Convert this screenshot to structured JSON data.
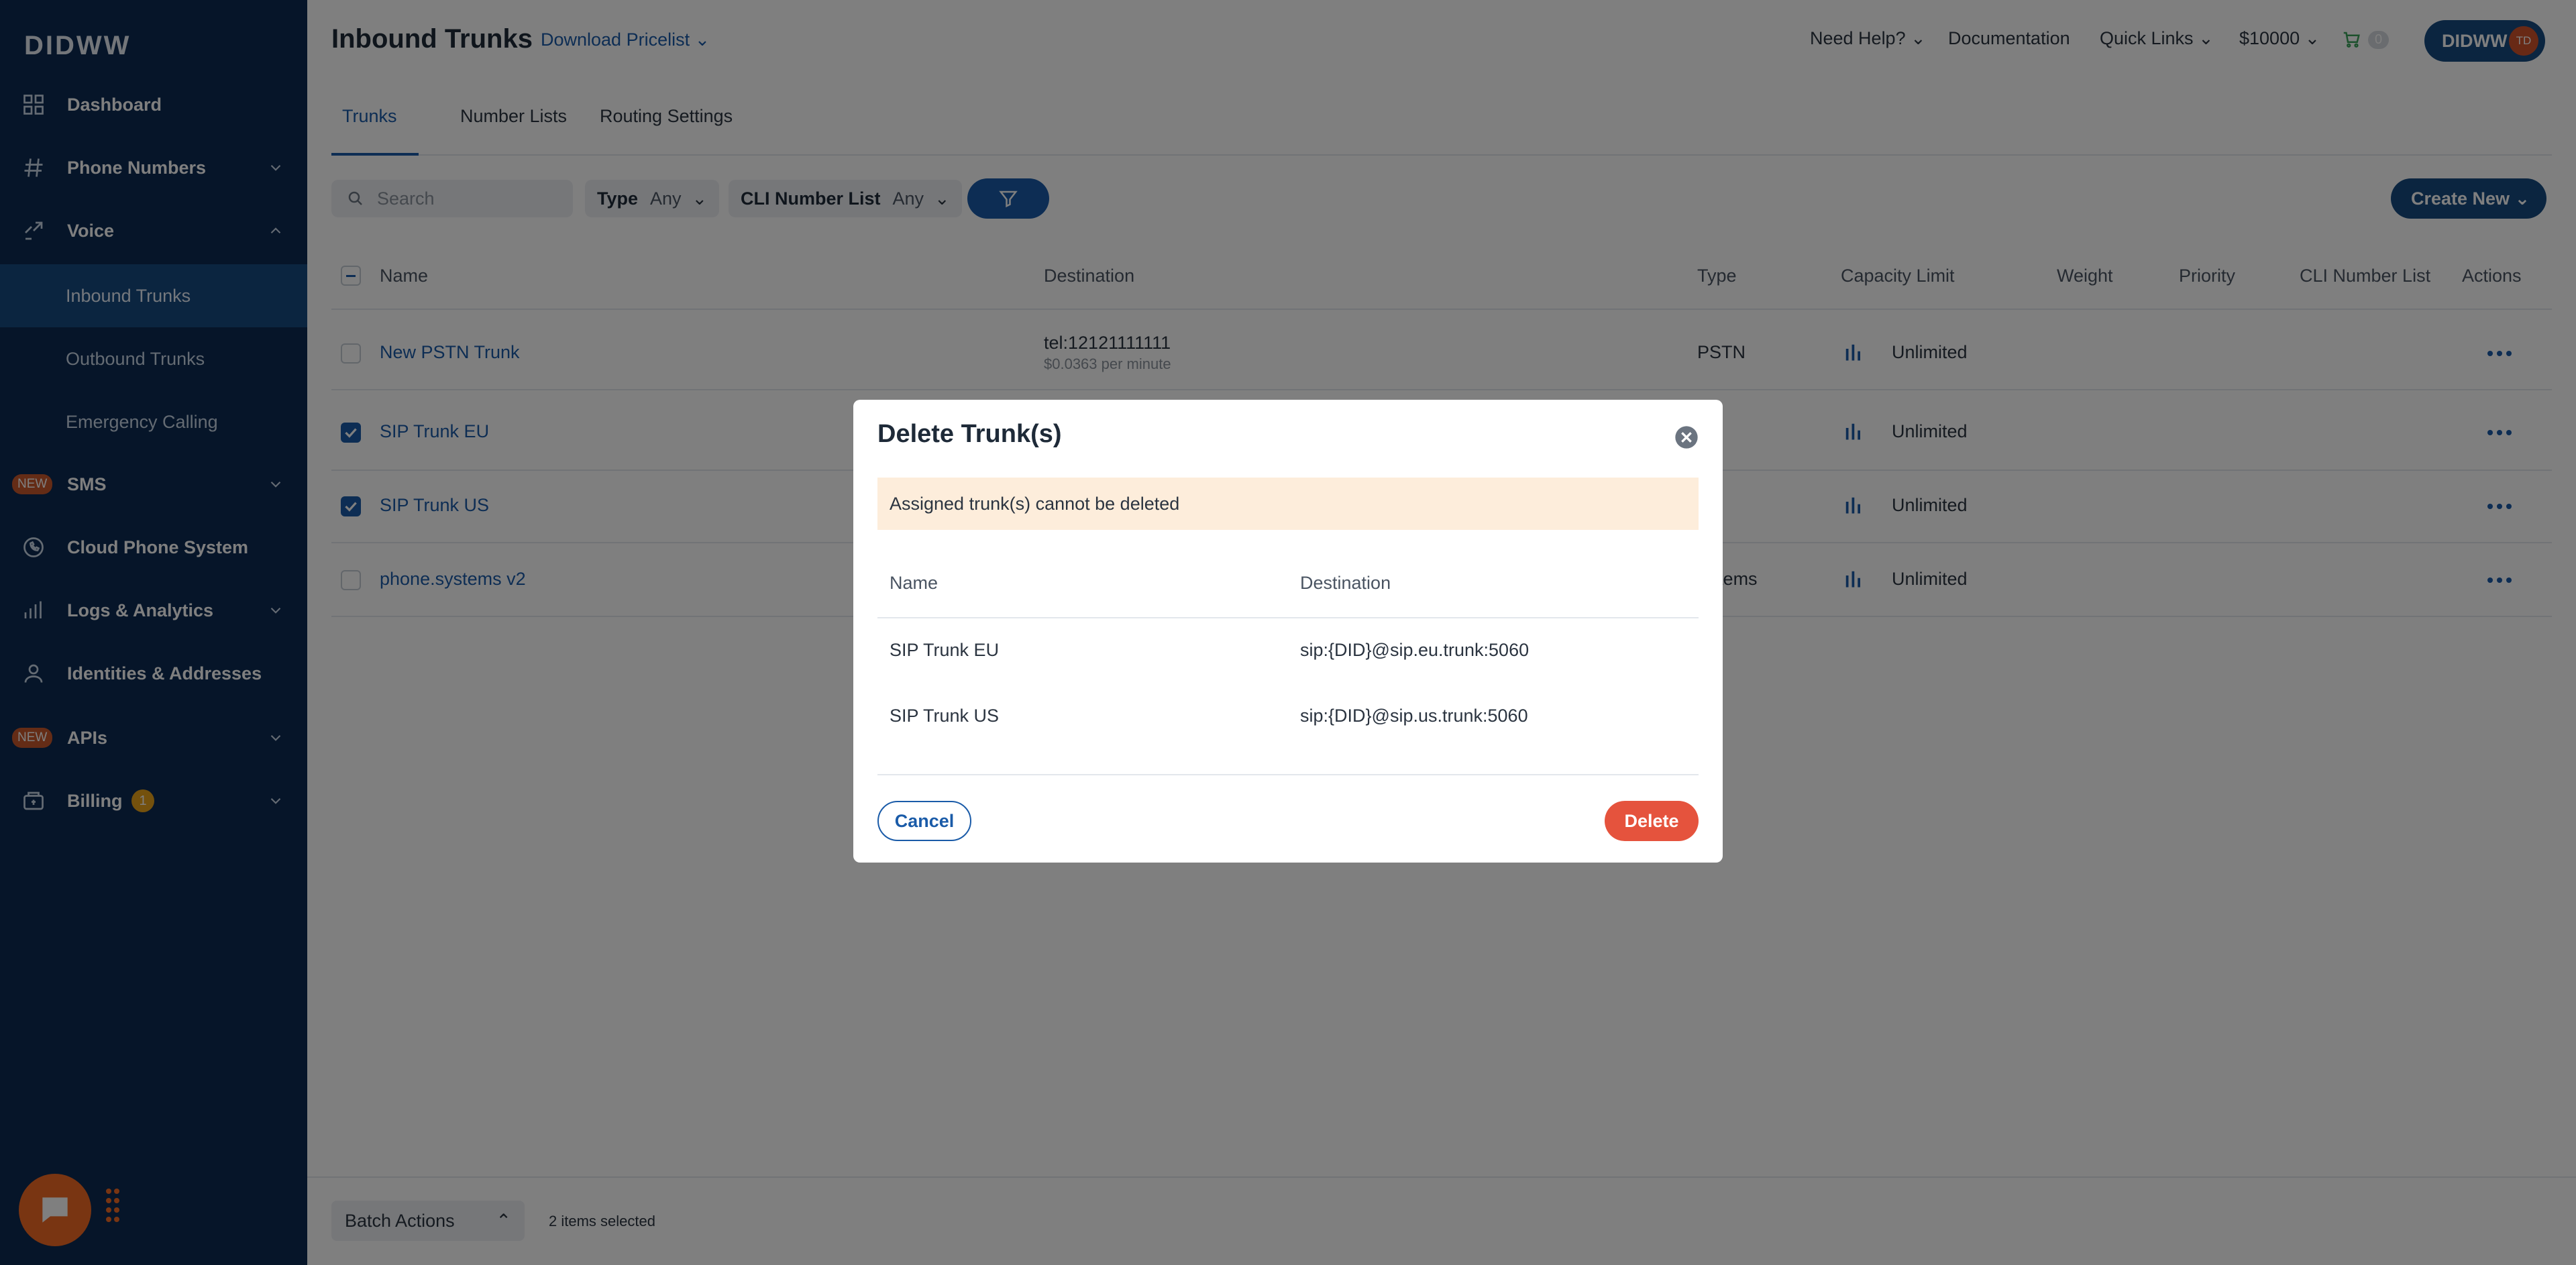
{
  "sidebar": {
    "logo": "DIDWW",
    "items": [
      {
        "label": "Dashboard",
        "icon": "grid-icon"
      },
      {
        "label": "Phone Numbers",
        "icon": "hash-icon"
      },
      {
        "label": "Voice",
        "icon": "voice-icon"
      },
      {
        "label": "SMS",
        "icon": "sms-icon",
        "badge": "NEW"
      },
      {
        "label": "Cloud Phone System",
        "icon": "phone-icon"
      },
      {
        "label": "Logs & Analytics",
        "icon": "chart-icon"
      },
      {
        "label": "Identities & Addresses",
        "icon": "user-icon"
      },
      {
        "label": "APIs",
        "icon": "api-icon",
        "badge": "NEW"
      },
      {
        "label": "Billing",
        "icon": "wallet-icon",
        "count": "1"
      }
    ],
    "voice_sub": [
      {
        "label": "Inbound Trunks"
      },
      {
        "label": "Outbound Trunks"
      },
      {
        "label": "Emergency Calling"
      }
    ]
  },
  "header": {
    "title": "Inbound Trunks",
    "pricelist": "Download Pricelist",
    "need_help": "Need Help?",
    "documentation": "Documentation",
    "quick_links": "Quick Links",
    "balance": "$10000",
    "cart_count": "0",
    "account": "DIDWW",
    "avatar_initials": "TD"
  },
  "tabs": [
    "Trunks",
    "Number Lists",
    "Routing Settings"
  ],
  "toolbar": {
    "search_placeholder": "Search",
    "type_label": "Type",
    "type_value": "Any",
    "cli_label": "CLI Number List",
    "cli_value": "Any",
    "create_label": "Create New"
  },
  "table": {
    "columns": [
      "Name",
      "Destination",
      "Type",
      "Capacity Limit",
      "Weight",
      "Priority",
      "CLI Number List",
      "Actions"
    ],
    "rows": [
      {
        "name": "New PSTN Trunk",
        "destination": "tel:12121111111",
        "rate": "$0.0363 per minute",
        "type": "PSTN",
        "capacity": "Unlimited",
        "checked": false
      },
      {
        "name": "SIP Trunk EU",
        "destination": "",
        "rate": "",
        "type": "",
        "capacity": "Unlimited",
        "checked": true
      },
      {
        "name": "SIP Trunk US",
        "destination": "",
        "rate": "",
        "type": "",
        "capacity": "Unlimited",
        "checked": true
      },
      {
        "name": "phone.systems v2",
        "destination": "",
        "rate": "",
        "type": "one.systems",
        "capacity": "Unlimited",
        "checked": false
      }
    ]
  },
  "footer": {
    "batch_label": "Batch Actions",
    "selected_text": "2 items selected"
  },
  "modal": {
    "title": "Delete Trunk(s)",
    "warning": "Assigned trunk(s) cannot be deleted",
    "col_name": "Name",
    "col_destination": "Destination",
    "rows": [
      {
        "name": "SIP Trunk EU",
        "destination": "sip:{DID}@sip.eu.trunk:5060"
      },
      {
        "name": "SIP Trunk US",
        "destination": "sip:{DID}@sip.us.trunk:5060"
      }
    ],
    "cancel": "Cancel",
    "delete": "Delete"
  },
  "colors": {
    "sidebar_bg": "#0d2b52",
    "accent": "#1a5ba8",
    "danger": "#e5533d",
    "warning_bg": "#fdeddb",
    "chat": "#f26b25"
  }
}
